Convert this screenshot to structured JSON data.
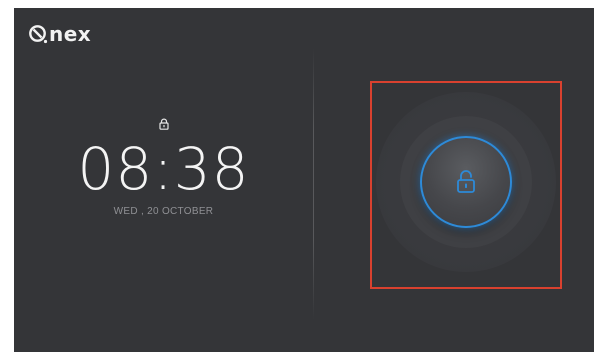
{
  "brand": {
    "logo_text": "nex",
    "logo_icon": "nex-logo-icon"
  },
  "lockscreen": {
    "status_icon": "lock-icon",
    "time": "08:38",
    "date": "WED , 20  OCTOBER"
  },
  "unlock": {
    "icon": "unlock-icon",
    "accent_color": "#2d8ad8",
    "highlight_color": "#d9412f"
  },
  "colors": {
    "background": "#343538",
    "text": "#f4f4f4",
    "muted_text": "#8f9094"
  }
}
